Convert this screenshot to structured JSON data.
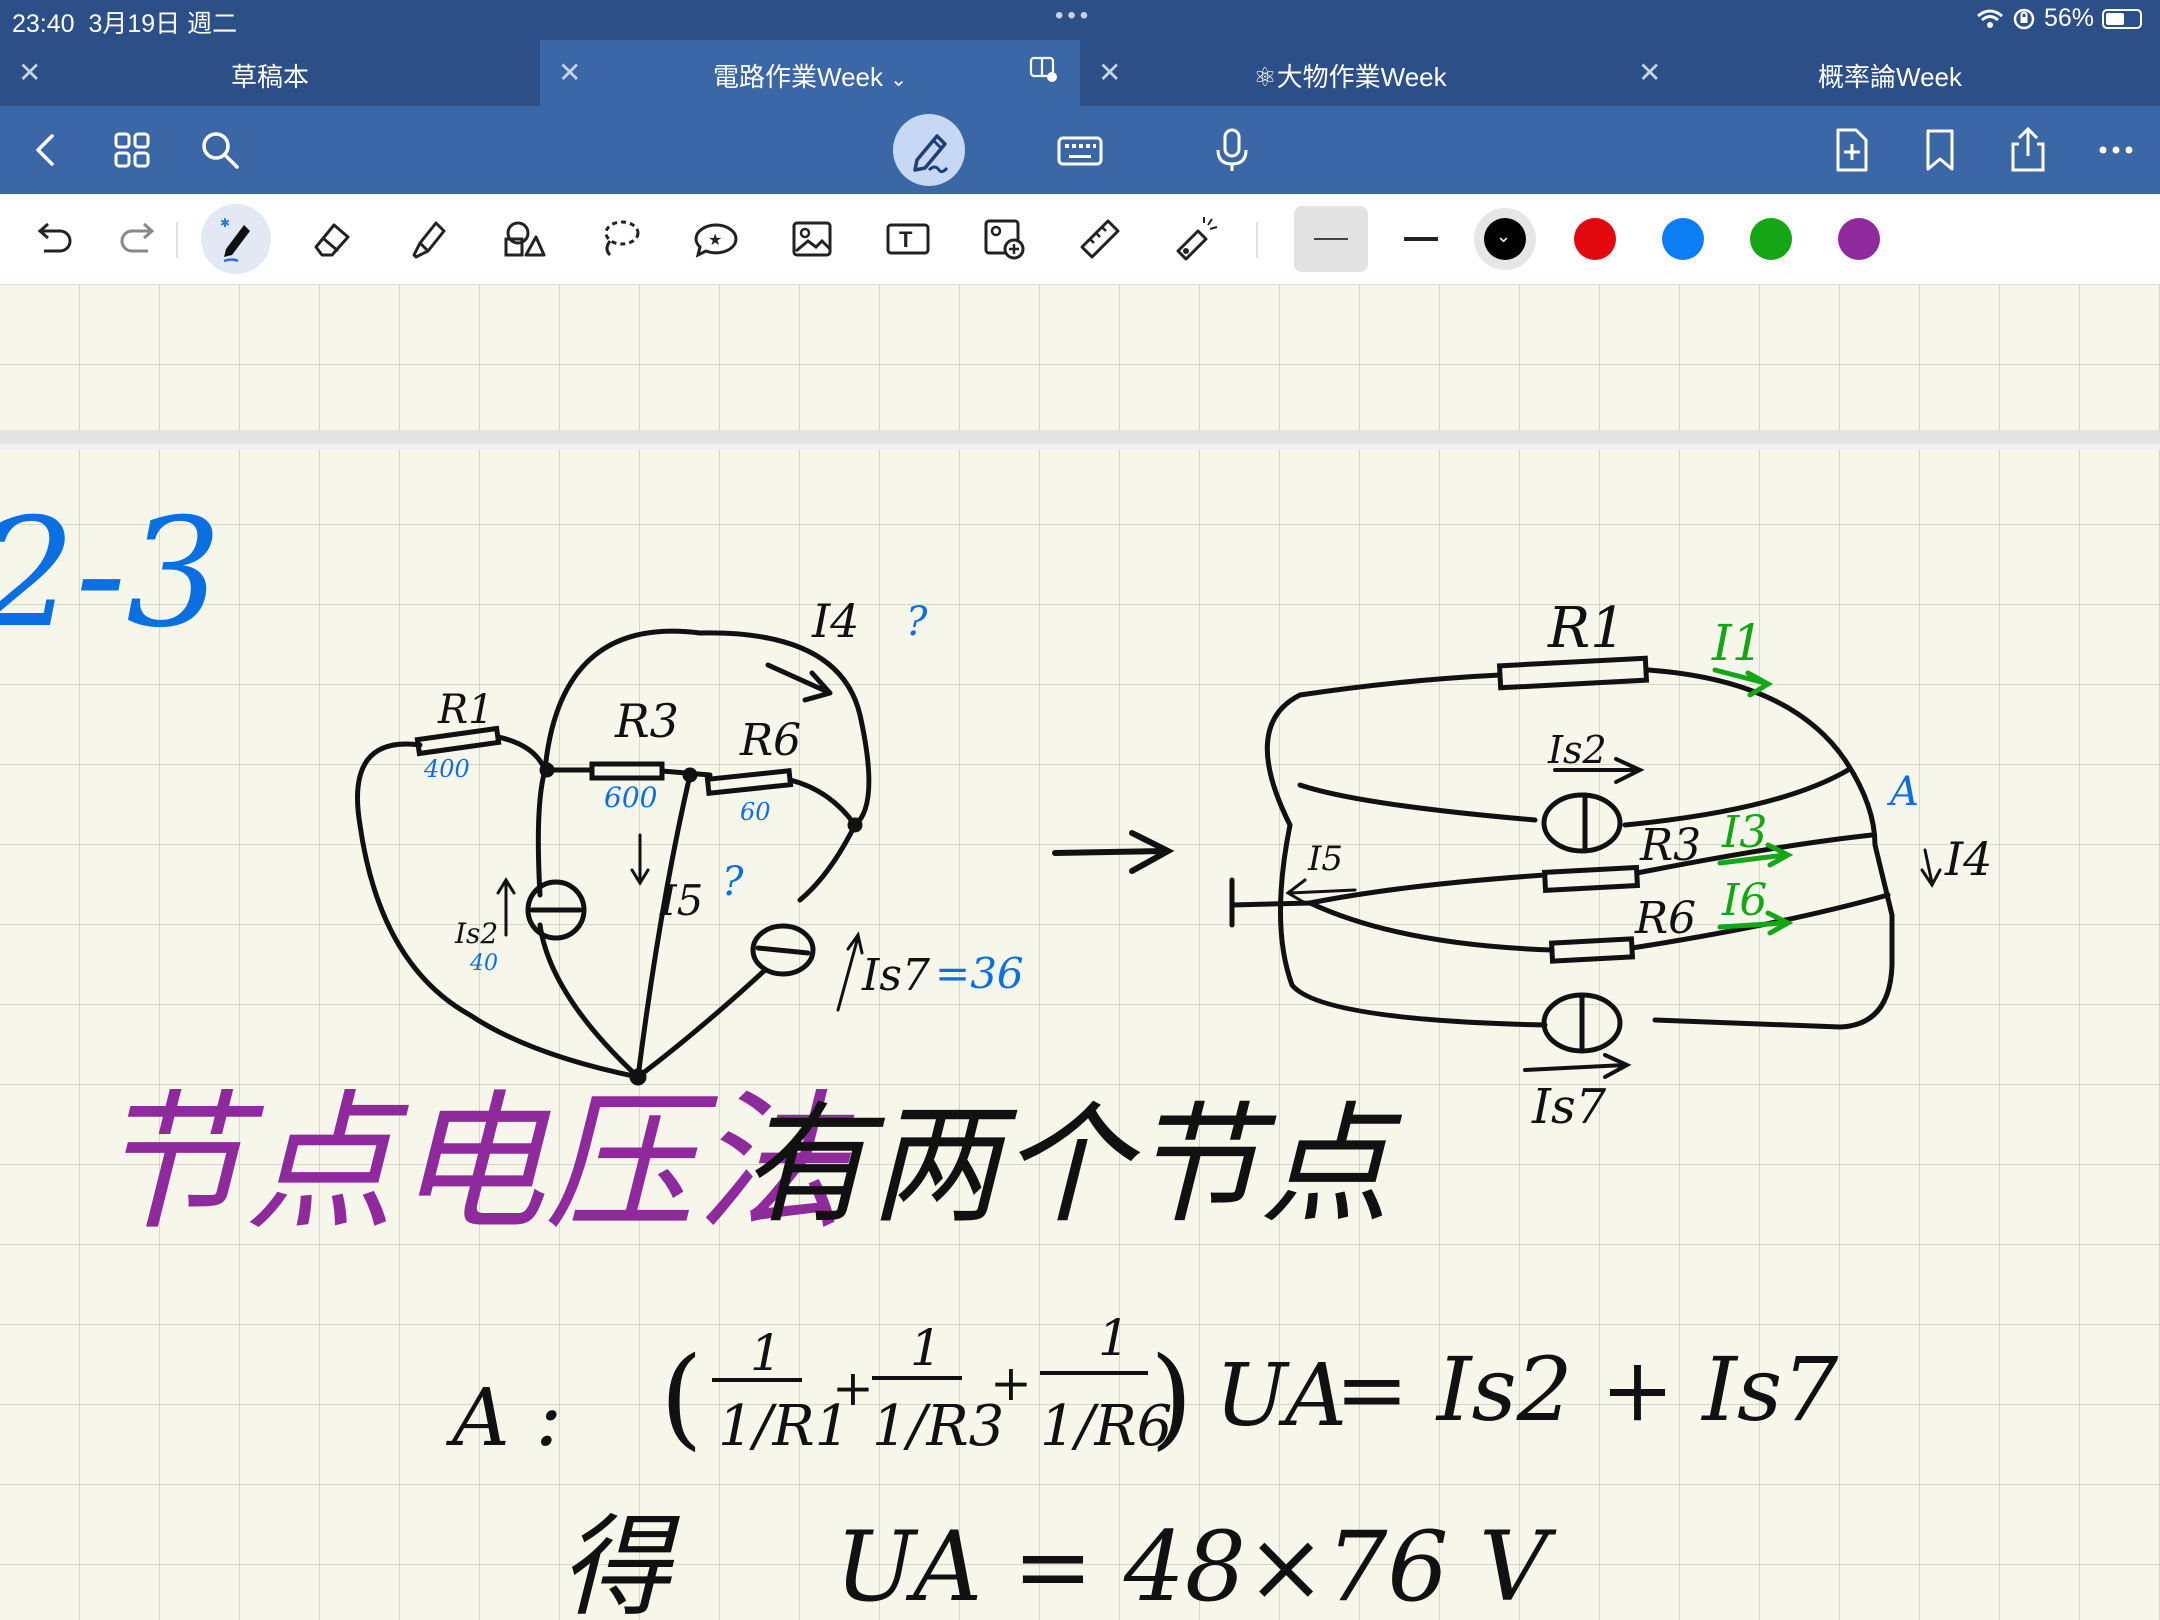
{
  "status_bar": {
    "time": "23:40",
    "date": "3月19日 週二",
    "battery_percent": "56%"
  },
  "tabs": [
    {
      "label": "草稿本",
      "active": false
    },
    {
      "label": "電路作業Week",
      "active": true,
      "has_dropdown": true
    },
    {
      "label": "⚛大物作業Week",
      "active": false
    },
    {
      "label": "概率論Week",
      "active": false
    }
  ],
  "navbar": {
    "icons": [
      "back-icon",
      "grid-icon",
      "search-icon",
      "pen-mode-icon",
      "keyboard-icon",
      "microphone-icon",
      "add-page-icon",
      "bookmark-icon",
      "share-icon",
      "more-icon"
    ]
  },
  "toolbar": {
    "tools": [
      "undo-icon",
      "redo-icon",
      "pen-icon",
      "eraser-icon",
      "highlighter-icon",
      "shapes-icon",
      "lasso-icon",
      "sticker-icon",
      "image-icon",
      "text-icon",
      "camera-image-icon",
      "ruler-icon",
      "laser-pointer-icon"
    ],
    "selected_tool": "pen",
    "colors": [
      "#000000",
      "#e3070e",
      "#0a7ff5",
      "#14a614",
      "#8e2a9c"
    ],
    "selected_color": "#000000"
  },
  "note": {
    "problem_number": "2-3",
    "left_circuit": {
      "labels": {
        "I4": "I4",
        "R1": "R1",
        "R1_value": "400",
        "R3": "R3",
        "R3_value": "600",
        "R6": "R6",
        "R6_value": "60",
        "Is2": "Is2",
        "Is2_value": "40",
        "I5": "I5",
        "Is7": "Is7",
        "Is7_value": "=36",
        "question1": "?",
        "question2": "?"
      }
    },
    "right_circuit": {
      "labels": {
        "R1": "R1",
        "I1": "I1",
        "Is2": "Is2",
        "A": "A",
        "I5": "I5",
        "R3": "R3",
        "I3": "I3",
        "I4": "I4",
        "R6": "R6",
        "I6": "I6",
        "Is7": "Is7"
      }
    },
    "method_title": "节点电压法",
    "method_note": "有两个节点",
    "equation_node": "A :",
    "equation_lhs_terms": [
      "1/R1",
      "1/R3",
      "1/R6"
    ],
    "equation_lhs_var": "UA",
    "equation_rhs": "= Is2 + Is7",
    "result_label": "得",
    "result": "UA = 48×76 V"
  }
}
